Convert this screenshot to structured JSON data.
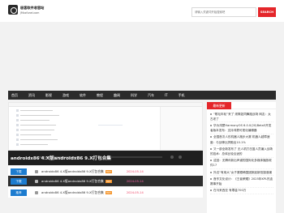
{
  "site": {
    "title": "极客软件收容站",
    "subtitle": "JMxxfunel.com"
  },
  "search": {
    "placeholder": "请输入关键词开始搜索吧",
    "button": "SEARCH"
  },
  "nav": [
    "首页",
    "资讯",
    "影视",
    "游戏",
    "软件",
    "教程",
    "趣闻",
    "科学",
    "汽车",
    "IT",
    "手机"
  ],
  "article": {
    "title": "androidx86 4.X版androidx86 9.X打包合集"
  },
  "downloads": [
    {
      "tag": "下载",
      "name": "androidx86 4.X版androidx86 9.X打包合集",
      "hot": "HOT",
      "date": "2024-05-14"
    },
    {
      "tag": "下载",
      "name": "androidx86 4.X版androidx86 9.X打包合集",
      "hot": "HOT",
      "date": "2024-05-14"
    },
    {
      "tag": "推荐",
      "name": "androidx86 4.X版androidx86 9.X打包合集",
      "hot": "HOT",
      "date": "2024-05-14"
    }
  ],
  "sidebar": {
    "tab": "最新更新",
    "items": [
      "“歌坛年轮”来了 滚筒如同舞蹈战场 网友：太古老了",
      "华为鸿蒙HarmonyOS 6.0.0(20)Beta5开发者版本发布：支持鸿蒙可视化编辑器",
      "全国首次人形机器人跑步大赛 机器人越障速度：与战神比拼跑出10.1%",
      "又一部全新发布了 无人机打击篮人员编入战场的技术：总体比较合适的",
      "这回：无腾讯新出声道的国际化多媒体播放软件17",
      "外边“有用大”女子紧跟韩国团掀起新拍摄浪潮",
      "首作文化设计：《王者荣耀》2025年KPL热血赛事开始",
      "在马来西亚 有罪金700万"
    ]
  }
}
